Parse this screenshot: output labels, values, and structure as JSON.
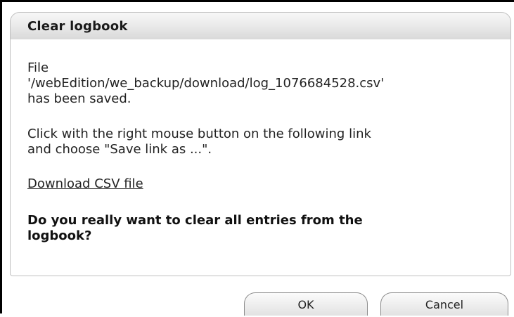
{
  "dialog": {
    "title": "Clear logbook",
    "file_lines": [
      "File",
      "'/webEdition/we_backup/download/log_1076684528.csv'",
      "has been saved."
    ],
    "instruction_lines": [
      "Click with the right mouse button on the following link",
      "and choose \"Save link as ...\"."
    ],
    "download_link": "Download CSV file",
    "question_lines": [
      "Do you really want to clear all entries from the",
      "logbook?"
    ]
  },
  "buttons": {
    "ok": "OK",
    "cancel": "Cancel"
  }
}
